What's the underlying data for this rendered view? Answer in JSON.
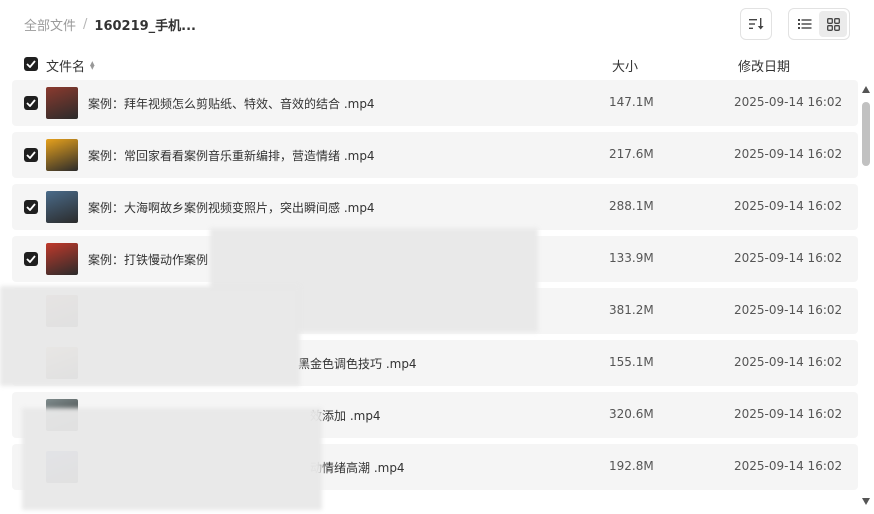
{
  "breadcrumb": {
    "root": "全部文件",
    "separator": "/",
    "current": "160219_手机..."
  },
  "toolbar": {
    "sort_icon": "sort-descending-icon",
    "list_view_icon": "list-view-icon",
    "grid_view_icon": "grid-view-icon"
  },
  "columns": {
    "name": "文件名",
    "size": "大小",
    "date": "修改日期"
  },
  "files": [
    {
      "name": "案例：拜年视频怎么剪贴纸、特效、音效的结合 .mp4",
      "size": "147.1M",
      "date": "2025-09-14 16:02",
      "checked": true,
      "thumb": "#8b3a2e"
    },
    {
      "name": "案例：常回家看看案例音乐重新编排，营造情绪 .mp4",
      "size": "217.6M",
      "date": "2025-09-14 16:02",
      "checked": true,
      "thumb": "#e6a11c"
    },
    {
      "name": "案例：大海啊故乡案例视频变照片，突出瞬间感 .mp4",
      "size": "288.1M",
      "date": "2025-09-14 16:02",
      "checked": true,
      "thumb": "#4a6b8a"
    },
    {
      "name": "案例：打铁慢动作案例",
      "size": "133.9M",
      "date": "2025-09-14 16:02",
      "checked": true,
      "thumb": "#c0392b"
    },
    {
      "name": "",
      "size": "381.2M",
      "date": "2025-09-14 16:02",
      "checked": false,
      "thumb": "#b07a6a"
    },
    {
      "name": "黑金色调色技巧 .mp4",
      "size": "155.1M",
      "date": "2025-09-14 16:02",
      "checked": false,
      "thumb": "#d9b28a"
    },
    {
      "name": "效添加 .mp4",
      "size": "320.6M",
      "date": "2025-09-14 16:02",
      "checked": false,
      "thumb": "#7f8c8d"
    },
    {
      "name": "动情绪高潮 .mp4",
      "size": "192.8M",
      "date": "2025-09-14 16:02",
      "checked": false,
      "thumb": "#5d6dbf"
    }
  ],
  "colors": {
    "row_bg": "#f5f5f5",
    "checkbox": "#1f1f1f",
    "scrollbar": "#c1c1c1"
  }
}
